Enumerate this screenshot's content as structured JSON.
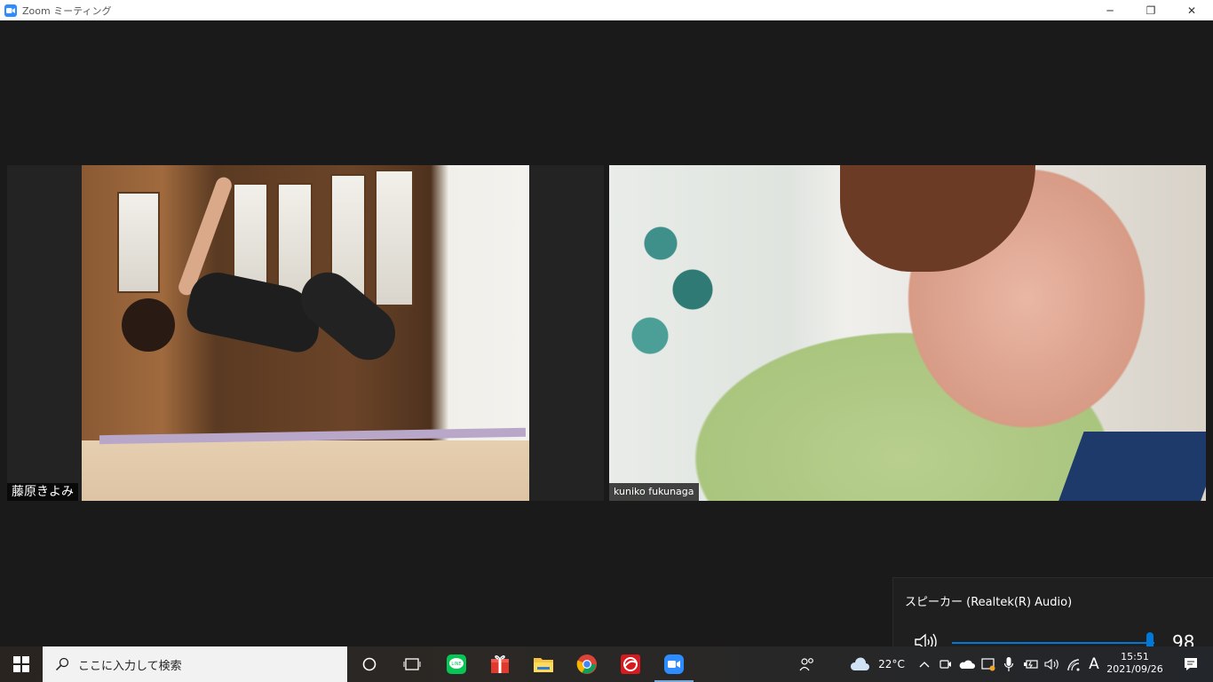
{
  "window": {
    "title": "Zoom ミーティング",
    "controls": {
      "minimize": "─",
      "maximize": "❐",
      "close": "✕"
    }
  },
  "participants": [
    {
      "name": "藤原きよみ"
    },
    {
      "name": "kuniko fukunaga"
    }
  ],
  "volume": {
    "device": "スピーカー (Realtek(R) Audio)",
    "value": "98",
    "level_percent": 98,
    "accent": "#0078d7"
  },
  "taskbar": {
    "search_placeholder": "ここに入力して検索",
    "apps": [
      "cortana-icon",
      "task-view-icon",
      "line-icon",
      "gift-icon",
      "file-explorer-icon",
      "chrome-icon",
      "trend-micro-icon",
      "zoom-icon"
    ],
    "weather": "22°C",
    "ime": "A",
    "time": "15:51",
    "date": "2021/09/26"
  }
}
